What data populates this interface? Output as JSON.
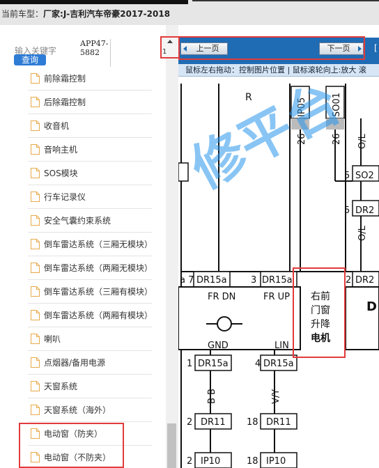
{
  "header": {
    "car_type_label": "当前车型：",
    "car_type_value": "厂家:J-吉利汽车帝豪2017-2018"
  },
  "sidebar": {
    "search_label": "输入关键字",
    "search_button": "查询",
    "code_line1": "APP47-",
    "code_line2": "5882",
    "items": [
      {
        "label": "前除霜控制"
      },
      {
        "label": "后除霜控制"
      },
      {
        "label": "收音机"
      },
      {
        "label": "音响主机"
      },
      {
        "label": "SOS模块"
      },
      {
        "label": "行车记录仪"
      },
      {
        "label": "安全气囊约束系统"
      },
      {
        "label": "倒车雷达系统（三厢无模块）"
      },
      {
        "label": "倒车雷达系统（两厢无模块）"
      },
      {
        "label": "倒车雷达系统（三厢有模块）"
      },
      {
        "label": "倒车雷达系统（两厢有模块）"
      },
      {
        "label": "喇叭"
      },
      {
        "label": "点烟器/备用电源"
      },
      {
        "label": "天窗系统"
      },
      {
        "label": "天窗系统（海外）"
      },
      {
        "label": "电动窗（防夹）"
      },
      {
        "label": "电动窗（不防夹）"
      }
    ],
    "scroll_page": "1"
  },
  "viewer": {
    "prev_label": "上一页",
    "next_label": "下一页",
    "bracket": "[",
    "hint": "鼠标左右拖动：控制图片位置 | 鼠标滚轮向上:放大  滚"
  },
  "diagram": {
    "watermark": "修平台",
    "labels": {
      "r": "R",
      "ip05": "IP05",
      "so01": "SO01",
      "n26a": "26",
      "n26b": "26",
      "ol1": "O/L",
      "ol2": "O/L",
      "n5a": "5",
      "n5b": "5",
      "so2": "SO2",
      "dr2a": "DR2",
      "dr2b": "DR2",
      "a7": "a 7",
      "dr15a_1": "DR15a",
      "n3": "3",
      "dr15a_2": "DR15a",
      "n2": "2",
      "fr_dn": "FR DN",
      "fr_up": "FR UP",
      "motor_line1": "右前",
      "motor_line2": "门窗",
      "motor_line3": "升降",
      "motor_line4": "电机",
      "gnd": "GND",
      "lin": "LIN",
      "d": "D",
      "n1": "1",
      "dr15a_3": "DR15a",
      "n4": "4",
      "dr15a_4": "DR15a",
      "bb": "B B",
      "vy": "V/Y",
      "n2b": "2",
      "dr11a": "DR11",
      "n18a": "18",
      "dr11b": "DR11",
      "n2c": "2",
      "ip10a": "IP10",
      "n18b": "18",
      "ip10b": "IP10"
    }
  }
}
